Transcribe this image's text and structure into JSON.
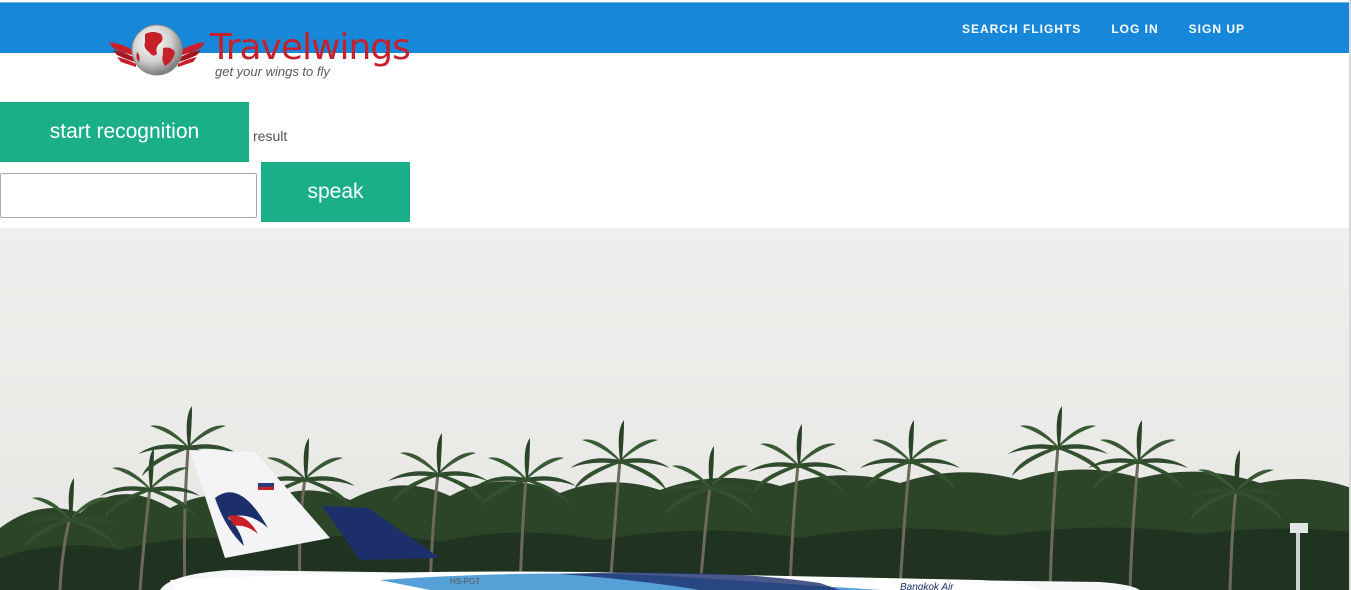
{
  "nav": {
    "links": [
      "SEARCH FLIGHTS",
      "LOG IN",
      "SIGN UP"
    ]
  },
  "brand": {
    "name": "Travelwings",
    "tagline": "get your wings to fly"
  },
  "controls": {
    "start_label": "start recognition",
    "result_label": "result",
    "speak_label": "speak",
    "input_value": ""
  },
  "hero": {
    "aircraft_registration": "HS-PGT",
    "aircraft_livery": "Bangkok Air"
  },
  "colors": {
    "nav_bg": "#1787da",
    "button_bg": "#1aaf89",
    "brand_red": "#c8202a"
  }
}
